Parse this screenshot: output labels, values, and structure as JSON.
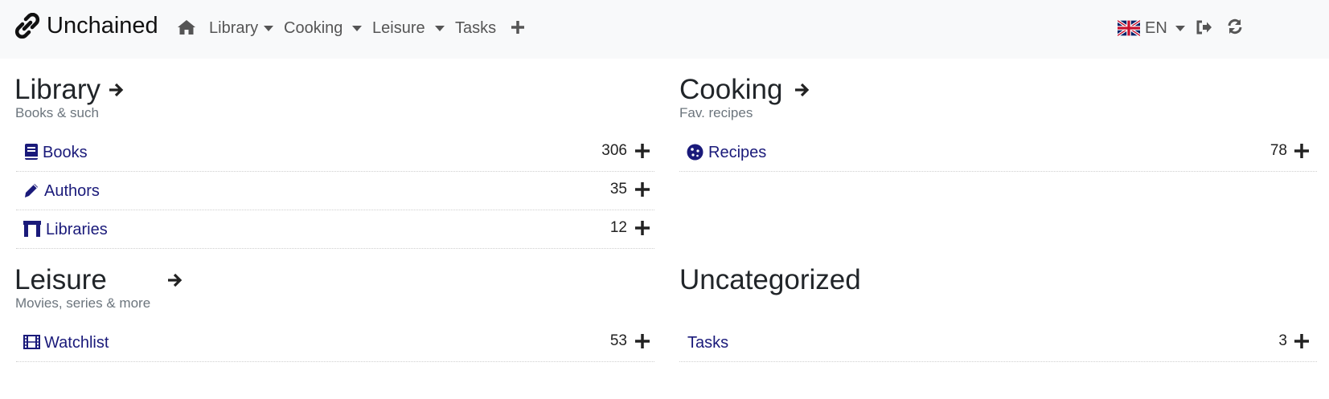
{
  "app": {
    "brand": "Unchained"
  },
  "nav": {
    "home_icon": "home-icon",
    "items": [
      {
        "label": "Library"
      },
      {
        "label": "Cooking"
      },
      {
        "label": "Leisure"
      },
      {
        "label": "Tasks"
      }
    ],
    "add_icon": "plus-icon",
    "language": "EN",
    "flag_icon": "uk-flag-icon",
    "logout_icon": "sign-out-icon",
    "refresh_icon": "refresh-icon"
  },
  "colors": {
    "link": "#1a1a7a",
    "navbar_bg": "#f8f9fa",
    "muted": "#6c757d"
  },
  "sections": {
    "library": {
      "title": "Library",
      "subtitle": "Books & such",
      "rows": [
        {
          "label": "Books",
          "count": "306",
          "icon": "book-icon"
        },
        {
          "label": "Authors",
          "count": "35",
          "icon": "pencil-icon"
        },
        {
          "label": "Libraries",
          "count": "12",
          "icon": "building-icon"
        }
      ]
    },
    "cooking": {
      "title": "Cooking",
      "subtitle": "Fav. recipes",
      "rows": [
        {
          "label": "Recipes",
          "count": "78",
          "icon": "cookie-icon"
        }
      ]
    },
    "leisure": {
      "title": "Leisure",
      "subtitle": "Movies, series & more",
      "rows": [
        {
          "label": "Watchlist",
          "count": "53",
          "icon": "film-icon"
        }
      ]
    },
    "uncategorized": {
      "title": "Uncategorized",
      "rows": [
        {
          "label": "Tasks",
          "count": "3"
        }
      ]
    }
  }
}
